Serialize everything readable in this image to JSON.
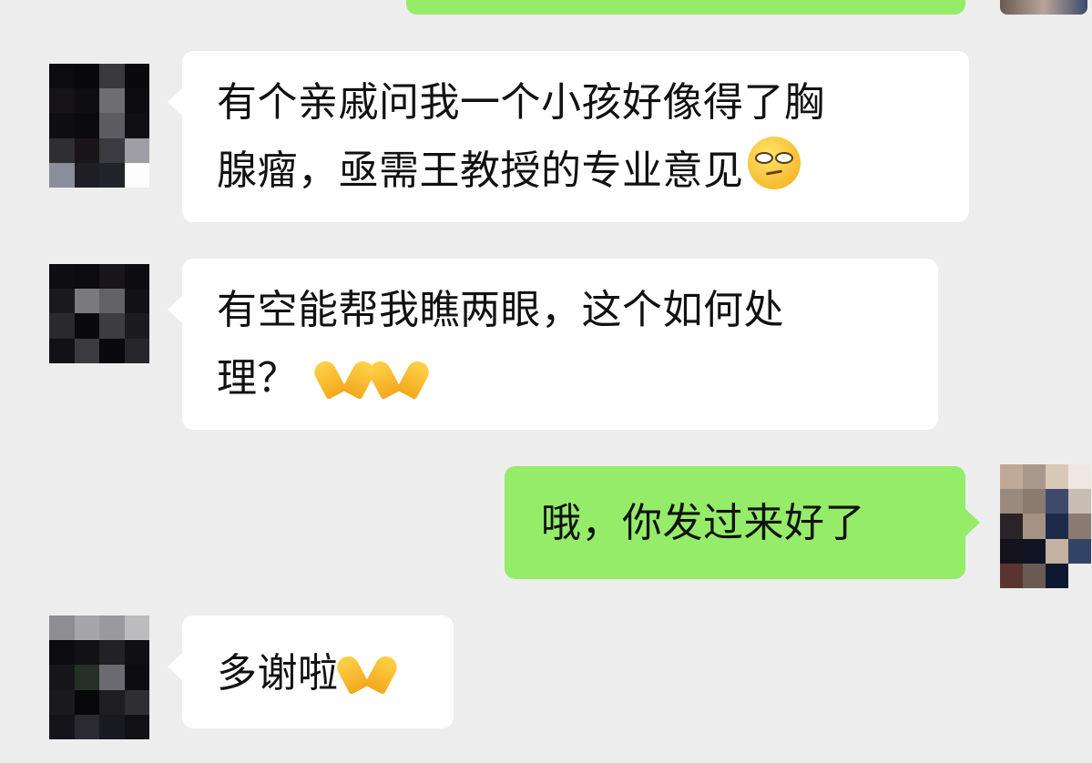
{
  "conversation": {
    "messages": [
      {
        "side": "incoming",
        "lines": [
          "有个亲戚问我一个小孩好像得了胸",
          "腺瘤，亟需王教授的专业意见"
        ],
        "trailing_emojis": [
          "thinking-face-emoji"
        ]
      },
      {
        "side": "incoming",
        "lines": [
          "有空能帮我瞧两眼，这个如何处",
          "理？"
        ],
        "trailing_emojis": [
          "folded-hands-emoji",
          "folded-hands-emoji"
        ]
      },
      {
        "side": "outgoing",
        "lines": [
          "哦，你发过来好了"
        ],
        "trailing_emojis": []
      },
      {
        "side": "incoming",
        "lines": [
          "多谢啦"
        ],
        "trailing_emojis": [
          "folded-hands-emoji"
        ]
      }
    ]
  },
  "colors": {
    "background": "#ededed",
    "incoming_bubble": "#ffffff",
    "outgoing_bubble": "#95ec69",
    "text": "#111111"
  }
}
